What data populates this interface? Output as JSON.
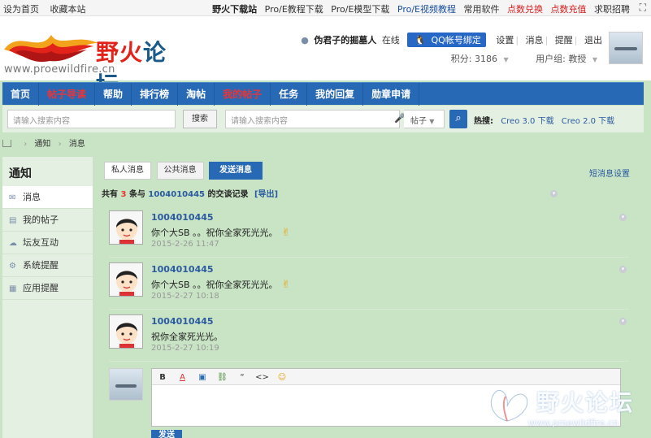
{
  "topbar": {
    "left": [
      "设为首页",
      "收藏本站"
    ],
    "site_name": "野火下载站",
    "links": [
      "Pro/E教程下载",
      "Pro/E模型下载"
    ],
    "video_link": "Pro/E视频教程",
    "common_software": "常用软件",
    "points_exchange": "点数兑换",
    "points_recharge": "点数充值",
    "recruit": "求职招聘"
  },
  "logo": {
    "brand_fire": "野火",
    "brand_forum": "论坛",
    "url": "www.proewildfire.cn"
  },
  "user": {
    "name": "伪君子的掘墓人",
    "status": "在线",
    "qq_bind": "QQ帐号绑定",
    "settings": "设置",
    "messages": "消息",
    "reminders": "提醒",
    "logout": "退出",
    "points": "积分: 3186",
    "group": "用户组: 教授"
  },
  "nav": {
    "items": [
      "首页",
      "帖子导读",
      "帮助",
      "排行榜",
      "淘帖",
      "我的帖子",
      "任务",
      "我的回复",
      "勋章申请"
    ]
  },
  "search": {
    "placeholder1": "请输入搜索内容",
    "button1": "搜索",
    "placeholder2": "请输入搜索内容",
    "type": "帖子",
    "hot_label": "热搜:",
    "hot_links": [
      "Creo 3.0 下载",
      "Creo 2.0 下载"
    ]
  },
  "breadcrumb": {
    "notice": "通知",
    "message": "消息"
  },
  "sidebar": {
    "title": "通知",
    "items": [
      {
        "label": "消息",
        "icon": "mail-icon"
      },
      {
        "label": "我的帖子",
        "icon": "document-icon"
      },
      {
        "label": "坛友互动",
        "icon": "people-icon"
      },
      {
        "label": "系统提醒",
        "icon": "gear-icon"
      },
      {
        "label": "应用提醒",
        "icon": "grid-icon"
      }
    ]
  },
  "main": {
    "tabs": [
      "私人消息",
      "公共消息"
    ],
    "send_tab": "发送消息",
    "settings_link": "短消息设置",
    "summary": {
      "prefix": "共有",
      "count": "3",
      "mid": "条与",
      "uid": "1004010445",
      "suffix": "的交谈记录",
      "export": "[导出]"
    },
    "messages": [
      {
        "sender": "1004010445",
        "text": "你个大SB 。。祝你全家死光光。",
        "emoji": "✌",
        "time": "2015-2-26 11:47"
      },
      {
        "sender": "1004010445",
        "text": "你个大SB 。。祝你全家死光光。",
        "emoji": "✌",
        "time": "2015-2-27 10:18"
      },
      {
        "sender": "1004010445",
        "text": "祝你全家死光光。",
        "emoji": "",
        "time": "2015-2-27 10:19"
      }
    ],
    "editor_toolbar": [
      "B",
      "A",
      "▣",
      "⛓",
      "“",
      "<>",
      "☺"
    ],
    "send_button": "发送"
  },
  "watermark": {
    "title": "野火论坛",
    "url": "www.proewildfire.cn"
  }
}
